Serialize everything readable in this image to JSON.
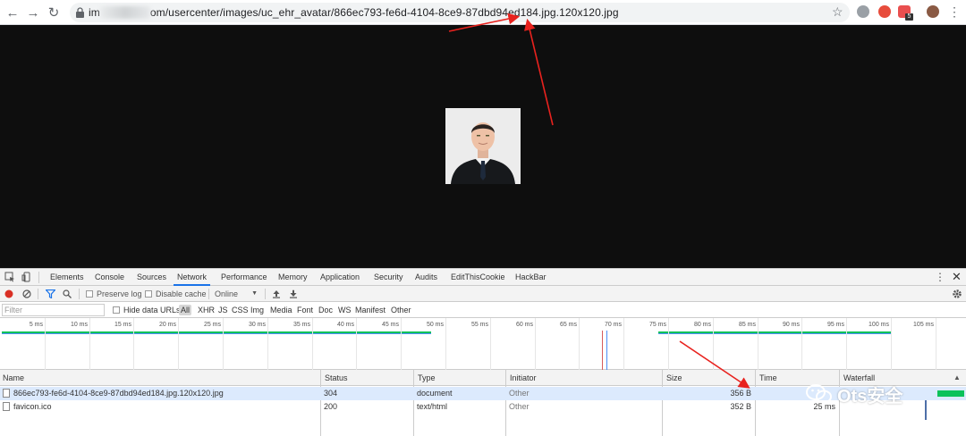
{
  "browser": {
    "url_prefix": "im",
    "url_suffix": "om/usercenter/images/uc_ehr_avatar/866ec793-fe6d-4104-8ce9-87dbd94ed184.jpg.120x120.jpg",
    "ext_badge": "5"
  },
  "devtools": {
    "tabs": [
      "Elements",
      "Console",
      "Sources",
      "Network",
      "Performance",
      "Memory",
      "Application",
      "Security",
      "Audits",
      "EditThisCookie",
      "HackBar"
    ],
    "active_tab": "Network",
    "controls": {
      "preserve_log": "Preserve log",
      "disable_cache": "Disable cache",
      "throttle": "Online"
    },
    "filter": {
      "placeholder": "Filter",
      "hide_data_urls": "Hide data URLs",
      "types": [
        "All",
        "XHR",
        "JS",
        "CSS",
        "Img",
        "Media",
        "Font",
        "Doc",
        "WS",
        "Manifest",
        "Other"
      ]
    },
    "ticks": [
      "5 ms",
      "10 ms",
      "15 ms",
      "20 ms",
      "25 ms",
      "30 ms",
      "35 ms",
      "40 ms",
      "45 ms",
      "50 ms",
      "55 ms",
      "60 ms",
      "65 ms",
      "70 ms",
      "75 ms",
      "80 ms",
      "85 ms",
      "90 ms",
      "95 ms",
      "100 ms",
      "105 ms"
    ],
    "columns": [
      "Name",
      "Status",
      "Type",
      "Initiator",
      "Size",
      "Time",
      "Waterfall"
    ],
    "rows": [
      {
        "name": "866ec793-fe6d-4104-8ce9-87dbd94ed184.jpg.120x120.jpg",
        "status": "304",
        "type": "document",
        "initiator": "Other",
        "size": "356 B",
        "time": ""
      },
      {
        "name": "favicon.ico",
        "status": "200",
        "type": "text/html",
        "initiator": "Other",
        "size": "352 B",
        "time": "25 ms"
      }
    ]
  },
  "watermark": "Ots安全",
  "colors": {
    "arrow": "#e8221e",
    "record": "#d93025",
    "accent": "#1a73e8",
    "waterfall_green": "#0cc25a"
  }
}
